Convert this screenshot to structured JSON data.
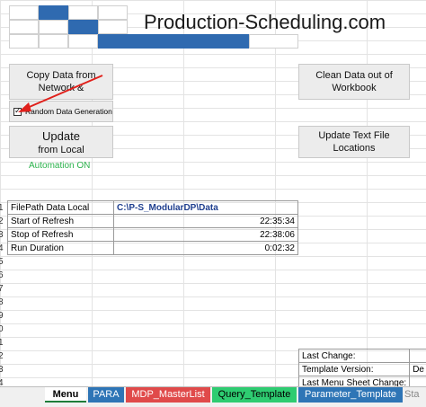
{
  "logo": {
    "text": "Production-Scheduling.com"
  },
  "buttons": {
    "copy_data": "Copy Data from Network &",
    "clean_data": "Clean Data out of Workbook",
    "update_main": "Update",
    "update_sub": "from Local",
    "update_text_file": "Update Text File Locations"
  },
  "checkbox": {
    "label": "Random Data Generation",
    "checked": true
  },
  "status": {
    "automation": "Automation ON"
  },
  "row_numbers": [
    "1",
    "2",
    "3",
    "4",
    "5",
    "6",
    "7",
    "8",
    "9",
    "0",
    "1",
    "2",
    "3",
    "4"
  ],
  "refresh_table": [
    {
      "label": "FilePath Data Local",
      "value": "C:\\P-S_ModularDP\\Data"
    },
    {
      "label": "Start of Refresh",
      "value": "22:35:34"
    },
    {
      "label": "Stop of Refresh",
      "value": "22:38:06"
    },
    {
      "label": "Run Duration",
      "value": "0:02:32"
    }
  ],
  "info_table": [
    {
      "label": "Last Change:",
      "value": ""
    },
    {
      "label": "Template Version:",
      "value": "De"
    },
    {
      "label": "Last Menu Sheet Change:",
      "value": ""
    }
  ],
  "tabs": [
    {
      "label": "Menu",
      "color": "#ffffff"
    },
    {
      "label": "PARA",
      "color": "#2e75b6"
    },
    {
      "label": "MDP_MasterList",
      "color": "#e04a4a"
    },
    {
      "label": "Query_Template",
      "color": "#2ecc71"
    },
    {
      "label": "Parameter_Template",
      "color": "#2e75b6"
    },
    {
      "label": "Sta",
      "color": "#f0f0f0"
    }
  ],
  "colors": {
    "logo_blue": "#2f6ab0",
    "automation_green": "#2bb24c",
    "path_blue": "#1f3f8f",
    "arrow_red": "#e0201b"
  }
}
